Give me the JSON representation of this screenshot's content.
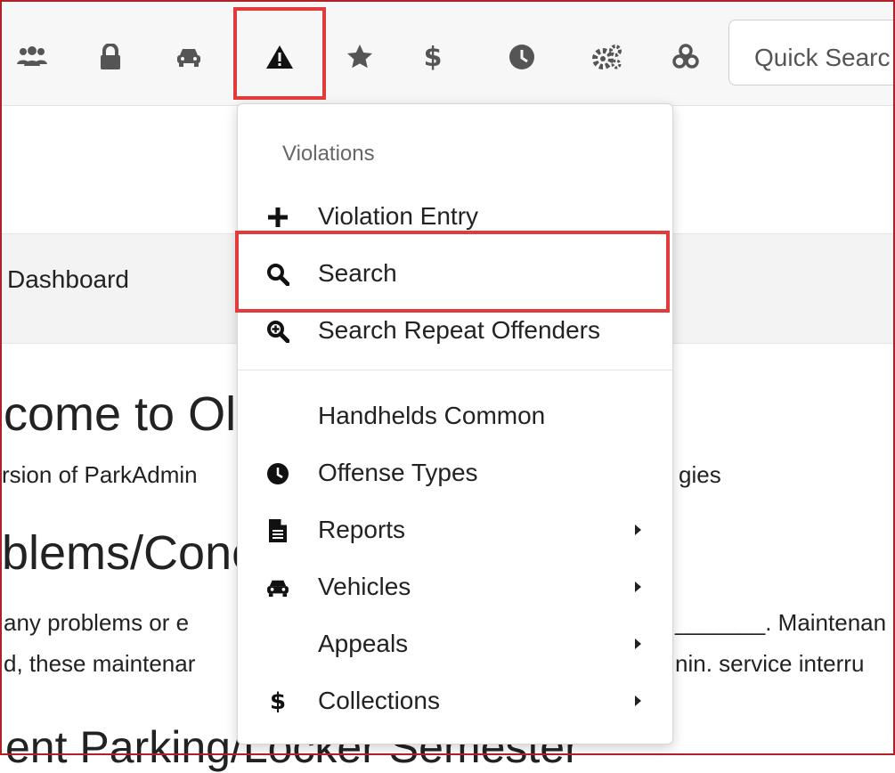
{
  "toolbar": {
    "icons": [
      "users-icon",
      "lock-icon",
      "car-icon",
      "alert-triangle-icon",
      "star-icon",
      "dollar-icon",
      "clock-icon",
      "cogs-icon",
      "biohazard-icon"
    ],
    "quick_search_placeholder": "Quick Searc"
  },
  "page": {
    "dashboard_label": "Dashboard",
    "welcome_heading": "come to Ol",
    "version_line_left": "rsion of ParkAdmin",
    "version_line_right": "gies",
    "problems_heading": "blems/Conc",
    "problems_line1_left": "any problems or e",
    "problems_line1_right": "_______. Maintenan",
    "problems_line2_left": "d, these maintenar",
    "problems_line2_right": "nin. service interru",
    "parking_heading": "ent Parking/Locker Semester"
  },
  "menu": {
    "header": "Violations",
    "items": [
      {
        "label": "Violation Entry",
        "icon": "plus-icon",
        "submenu": false
      },
      {
        "label": "Search",
        "icon": "search-icon",
        "submenu": false
      },
      {
        "label": "Search Repeat Offenders",
        "icon": "search-plus-icon",
        "submenu": false
      },
      {
        "label": "Handhelds Common",
        "icon": "",
        "submenu": false
      },
      {
        "label": "Offense Types",
        "icon": "clock-icon",
        "submenu": false
      },
      {
        "label": "Reports",
        "icon": "file-icon",
        "submenu": true
      },
      {
        "label": "Vehicles",
        "icon": "car-icon",
        "submenu": true
      },
      {
        "label": "Appeals",
        "icon": "",
        "submenu": true
      },
      {
        "label": "Collections",
        "icon": "dollar-icon",
        "submenu": true
      }
    ]
  },
  "colors": {
    "highlight": "#e23b3b",
    "frame": "#b21f24"
  }
}
